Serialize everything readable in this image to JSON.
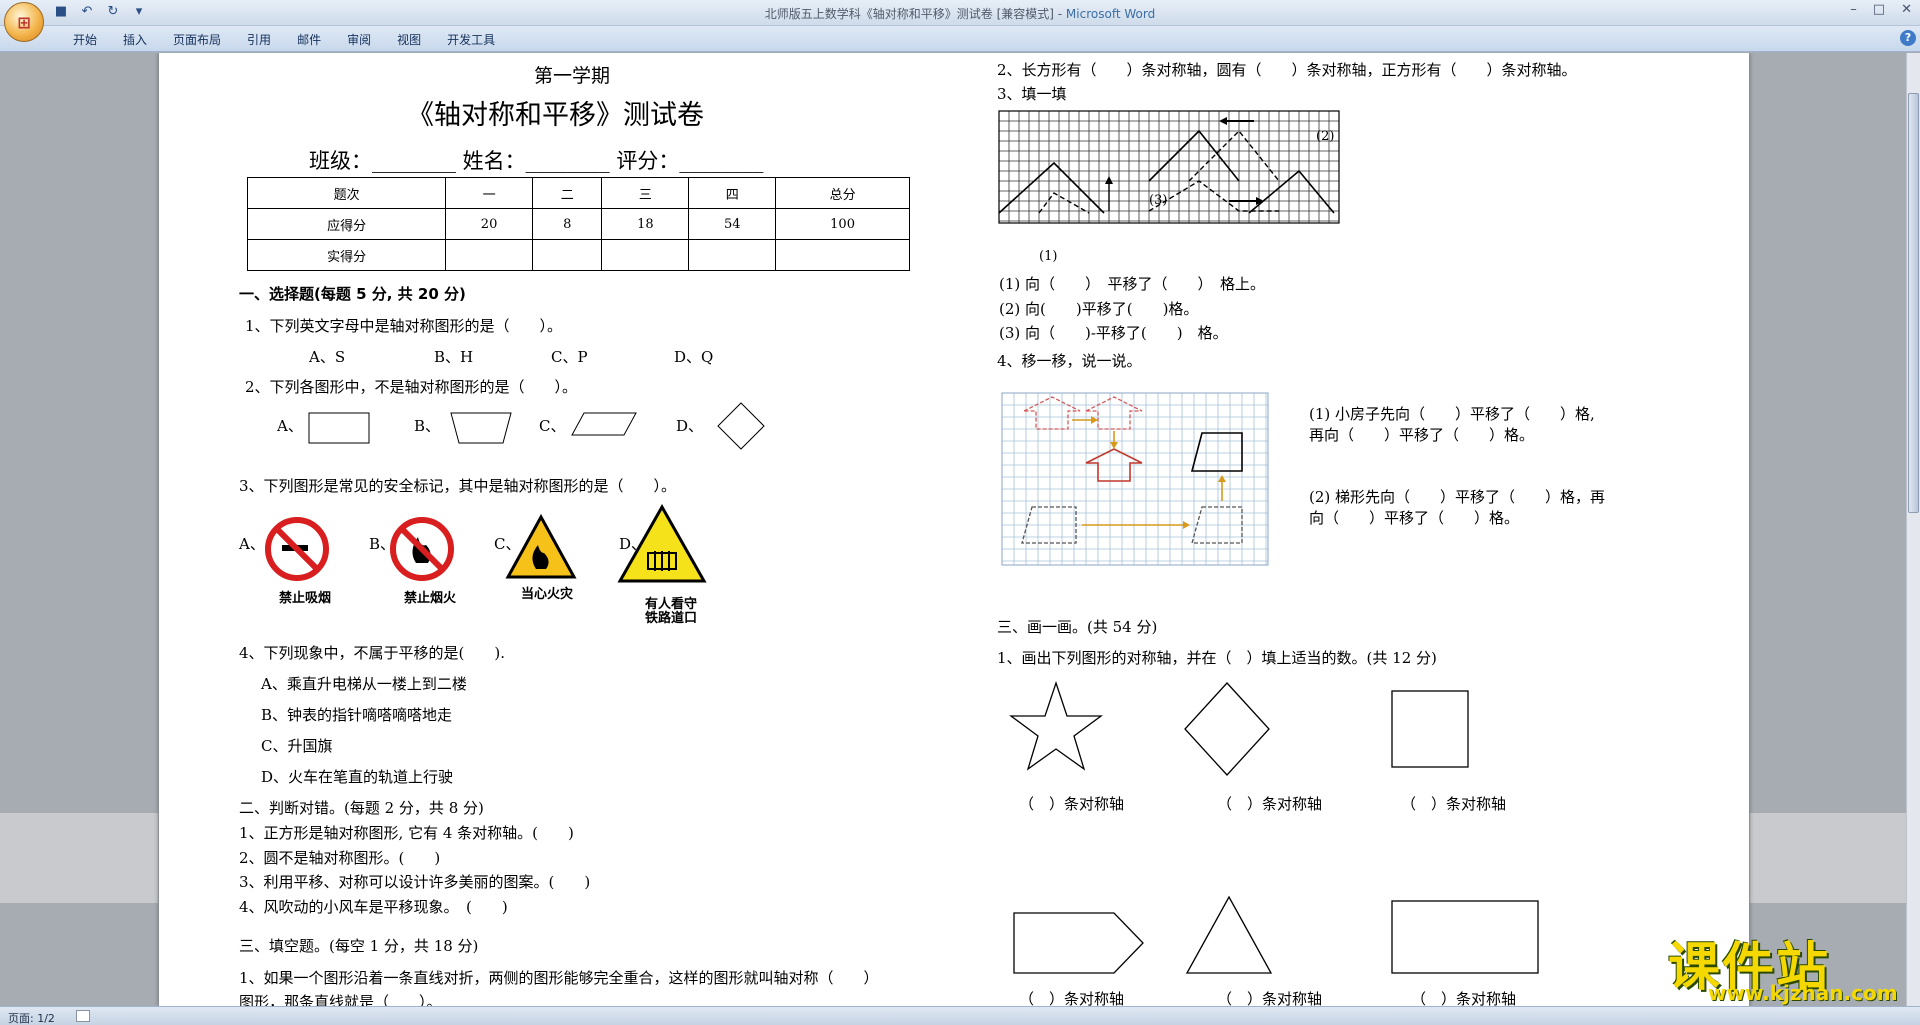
{
  "window": {
    "title": "北师版五上数学科《轴对称和平移》测试卷 [兼容模式] - ",
    "app_name": "Microsoft Word"
  },
  "ribbon": {
    "tabs": [
      "开始",
      "插入",
      "页面布局",
      "引用",
      "邮件",
      "审阅",
      "视图",
      "开发工具"
    ]
  },
  "statusbar": {
    "page": "页面: 1/2"
  },
  "header": {
    "semester": "第一学期",
    "title": "《轴对称和平移》测试卷",
    "info": "班级：________   姓名：________   评分：________"
  },
  "score_table": {
    "rows": [
      [
        "题次",
        "一",
        "二",
        "三",
        "四",
        "总分"
      ],
      [
        "应得分",
        "20",
        "8",
        "18",
        "54",
        "100"
      ],
      [
        "实得分",
        "",
        "",
        "",
        "",
        ""
      ]
    ]
  },
  "left": {
    "s1_title": "一、选择题(每题 5 分, 共 20 分)",
    "q1": "1、下列英文字母中是轴对称图形的是（　　）。",
    "q1_opts": [
      "A、S",
      "B、H",
      "C、P",
      "D、Q"
    ],
    "q2": "2、下列各图形中，不是轴对称图形的是（　　）。",
    "q2_opts": [
      "A、",
      "B、",
      "C、",
      "D、"
    ],
    "q3": "3、下列图形是常见的安全标记，其中是轴对称图形的是（　　）。",
    "q3_opts": [
      "A、",
      "B、",
      "C、",
      "D、"
    ],
    "signs": [
      "禁止吸烟",
      "禁止烟火",
      "当心火灾",
      "有人看守",
      "铁路道口"
    ],
    "q4": "4、下列现象中，不属于平移的是(　　).",
    "q4_opts": [
      "A、乘直升电梯从一楼上到二楼",
      "B、钟表的指针嘀嗒嘀嗒地走",
      "C、升国旗",
      "D、火车在笔直的轨道上行驶"
    ],
    "s2_title": "二、判断对错。(每题 2 分，共 8 分)",
    "s2_items": [
      "1、正方形是轴对称图形, 它有 4 条对称轴。(　　)",
      "2、圆不是轴对称图形。(　　)",
      "3、利用平移、对称可以设计许多美丽的图案。(　　)",
      "4、风吹动的小风车是平移现象。　(　　)"
    ],
    "s3_title": "三、填空题。(每空 1 分，共 18 分)",
    "s3_q1": "1、如果一个图形沿着一条直线对折，两侧的图形能够完全重合，这样的图形就叫轴对称（　　）",
    "s3_q1b": "图形，那条直线就是（　　）。"
  },
  "right": {
    "q2": "2、长方形有（　　）条对称轴，圆有（　　）条对称轴，正方形有（　　）条对称轴。",
    "q3": "3、填一填",
    "grid_labels": [
      "(1)",
      "(2)",
      "(3)"
    ],
    "q3_items": [
      "(1) 向（　　）　平移了（　　）　格上。",
      "(2) 向(　　)平移了(　　)格。",
      "(3) 向（　　)-平移了(　　)　格。"
    ],
    "q4": "4、移一移，说一说。",
    "q4_house_a": "(1) 小房子先向（　　）平移了（　　）格,",
    "q4_house_b": "再向（　　）平移了（　　）格。",
    "q4_trap_a": "(2) 梯形先向（　　）平移了（　　）格，再",
    "q4_trap_b": "向（　　）平移了（　　）格。",
    "s4_title": "三、画一画。(共 54 分)",
    "s4_q1": "1、画出下列图形的对称轴，并在（　）填上适当的数。(共 12 分)",
    "axis_label": "（　）条对称轴"
  },
  "watermark": {
    "cn": "课件站",
    "url": "www.kjzhan.com"
  }
}
